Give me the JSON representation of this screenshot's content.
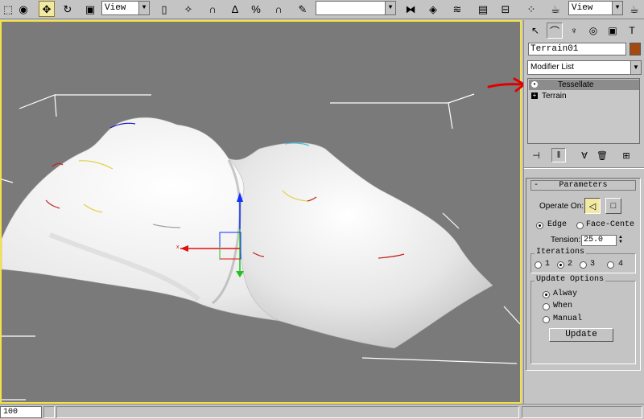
{
  "toolbar": {
    "reference_coord": "View",
    "view_dropdown": "View",
    "edit_named_selection": ""
  },
  "status": {
    "frame_value": "100"
  },
  "viewport": {
    "border_color": "#f3e34b",
    "background": "#7a7a7a"
  },
  "panel": {
    "object_name": "Terrain01",
    "object_color": "#a34a12",
    "modifier_list": "Modifier List",
    "stack": [
      {
        "label": "Tessellate",
        "selected": true,
        "icon": "lightbulb-icon"
      },
      {
        "label": "Terrain",
        "selected": false,
        "icon": "plus-icon"
      }
    ],
    "rollout": {
      "toggle": "-",
      "title": "Parameters",
      "operate_on_label": "Operate On:",
      "edge_label": "Edge",
      "face_center_label": "Face-Cente",
      "tension_label": "Tension:",
      "tension_value": "25.0",
      "iterations_label": "Iterations",
      "iterations": [
        "1",
        "2",
        "3",
        "4"
      ],
      "iterations_selected": "2",
      "update_options_label": "Update Options",
      "update_always": "Alway",
      "update_when": "When",
      "update_manual": "Manual",
      "update_button": "Update"
    }
  },
  "annotation": {
    "arrow_color": "#e00000"
  }
}
